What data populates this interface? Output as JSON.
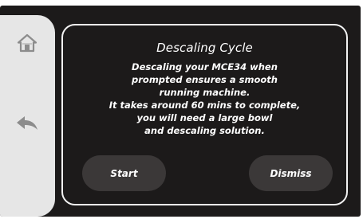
{
  "sidebar": {
    "home_icon": "home-icon",
    "back_icon": "back-arrow-icon"
  },
  "dialog": {
    "title": "Descaling Cycle",
    "body_lines": [
      "Descaling your MCE34  when",
      "prompted ensures a smooth",
      "running machine.",
      "It takes around 60 mins to complete,",
      "you will need  a large bowl",
      "and descaling solution."
    ],
    "start_label": "Start",
    "dismiss_label": "Dismiss"
  },
  "colors": {
    "background": "#1c1a1a",
    "sidebar": "#e6e6e6",
    "icon": "#8c8c8c",
    "button": "#3b3838",
    "text": "#ffffff"
  }
}
